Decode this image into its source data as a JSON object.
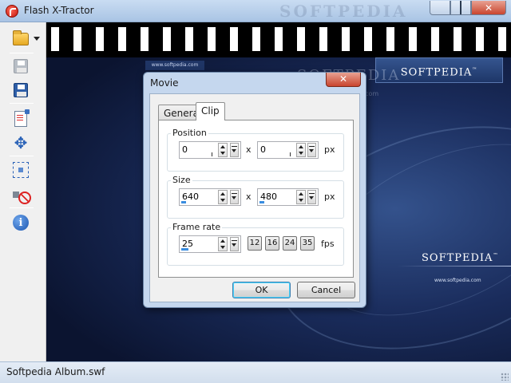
{
  "window": {
    "title": "Flash X-Tractor",
    "title_watermark": "SOFTPEDIA"
  },
  "toolbar": {
    "items": [
      {
        "icon": "open-folder-icon",
        "label": "Open"
      },
      {
        "icon": "save-disabled-icon",
        "label": "Save"
      },
      {
        "icon": "save-as-icon",
        "label": "Save As"
      },
      {
        "icon": "properties-doc-icon",
        "label": "Properties"
      },
      {
        "icon": "move-icon",
        "label": "Move"
      },
      {
        "icon": "resize-icon",
        "label": "Resize"
      },
      {
        "icon": "mute-icon",
        "label": "Mute"
      },
      {
        "icon": "info-icon",
        "label": "About"
      }
    ]
  },
  "content": {
    "film_url": "www.softpedia.com",
    "logo_top": "SOFTPEDIA",
    "watermark": "SOFTPEDIA",
    "watermark_url": "www.softpedia.com",
    "logo_bottom": "SOFTPEDIA",
    "url_bottom": "www.softpedia.com"
  },
  "dialog": {
    "title": "Movie",
    "tabs": [
      {
        "label": "General",
        "active": false
      },
      {
        "label": "Clip",
        "active": true
      }
    ],
    "position": {
      "label": "Position",
      "x": "0",
      "y": "0",
      "separator": "x",
      "unit": "px"
    },
    "size": {
      "label": "Size",
      "width": "640",
      "height": "480",
      "separator": "x",
      "unit": "px"
    },
    "frame_rate": {
      "label": "Frame rate",
      "value": "25",
      "presets": [
        "12",
        "16",
        "24",
        "35"
      ],
      "unit": "fps"
    },
    "ok_label": "OK",
    "cancel_label": "Cancel"
  },
  "statusbar": {
    "text": "Softpedia Album.swf"
  },
  "colors": {
    "accent": "#3a8de0",
    "titlebar": "#b9d1ea",
    "close": "#c9452e"
  }
}
